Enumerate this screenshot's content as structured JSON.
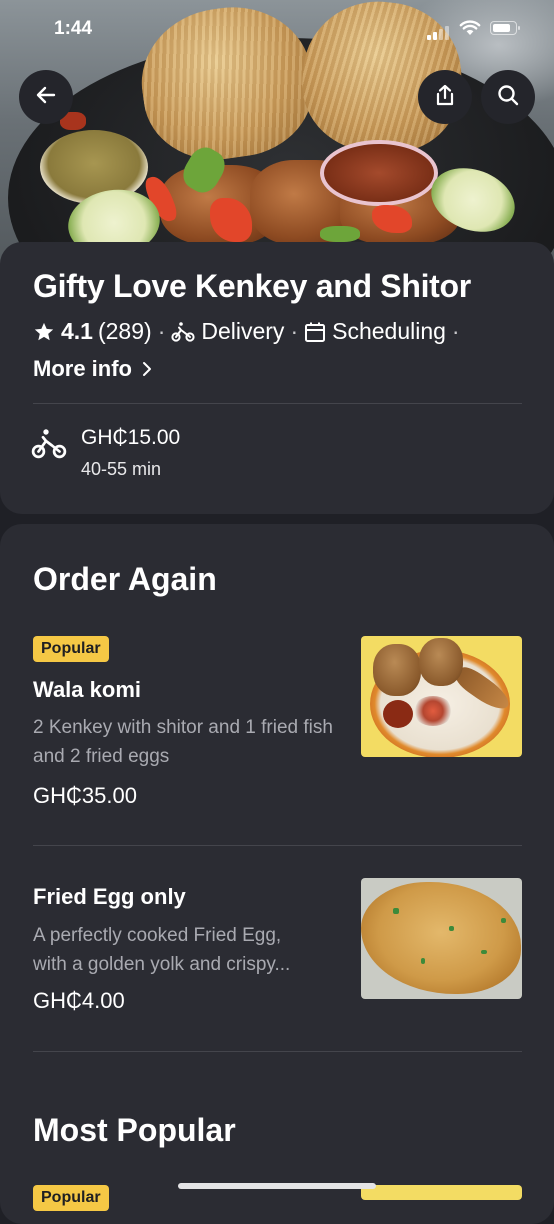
{
  "status_bar": {
    "time": "1:44"
  },
  "header": {
    "back_icon": "arrow-left-icon",
    "share_icon": "share-icon",
    "search_icon": "search-icon"
  },
  "store": {
    "name": "Gifty Love Kenkey and Shitor",
    "rating": "4.1",
    "rating_count": "(289)",
    "separator": "·",
    "delivery_label": "Delivery",
    "scheduling_label": "Scheduling",
    "more_info_label": "More info",
    "delivery_fee": "GH₵15.00",
    "delivery_time": "40-55 min"
  },
  "menu": {
    "sections": [
      {
        "title": "Order Again",
        "items": [
          {
            "badge": "Popular",
            "name": "Wala komi",
            "description": "2 Kenkey with shitor and 1 fried fish and 2 fried eggs",
            "price": "GH₵35.00"
          },
          {
            "badge": "",
            "name": "Fried Egg only",
            "description": "A perfectly cooked Fried Egg, with a golden yolk and crispy…",
            "description_line1": "A perfectly cooked Fried Egg,",
            "description_line2": "with a golden yolk and crispy...",
            "price": "GH₵4.00"
          }
        ]
      },
      {
        "title": "Most Popular",
        "items": [
          {
            "badge": "Popular"
          }
        ]
      }
    ]
  },
  "colors": {
    "background": "#1f2026",
    "card": "#2b2c33",
    "badge": "#f5c845",
    "muted_text": "#a9aab1"
  }
}
